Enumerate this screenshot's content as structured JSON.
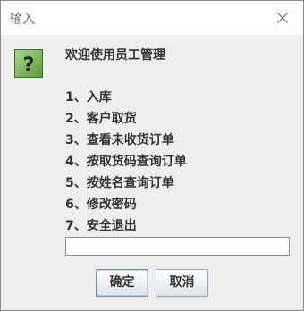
{
  "window": {
    "title": "输入",
    "close_glyph": "close-icon"
  },
  "dialog": {
    "icon": "question-icon",
    "icon_colors": {
      "fill": "#6aa84f",
      "border": "#2e5c1e",
      "mark": "#1a2a0e"
    },
    "welcome": "欢迎使用员工管理",
    "menu": [
      "1、入库",
      "2、客户取货",
      "3、查看未收货订单",
      "4、按取货码查询订单",
      "5、按姓名查询订单",
      "6、修改密码",
      "7、安全退出"
    ],
    "input_value": "",
    "ok_label": "确定",
    "cancel_label": "取消"
  }
}
